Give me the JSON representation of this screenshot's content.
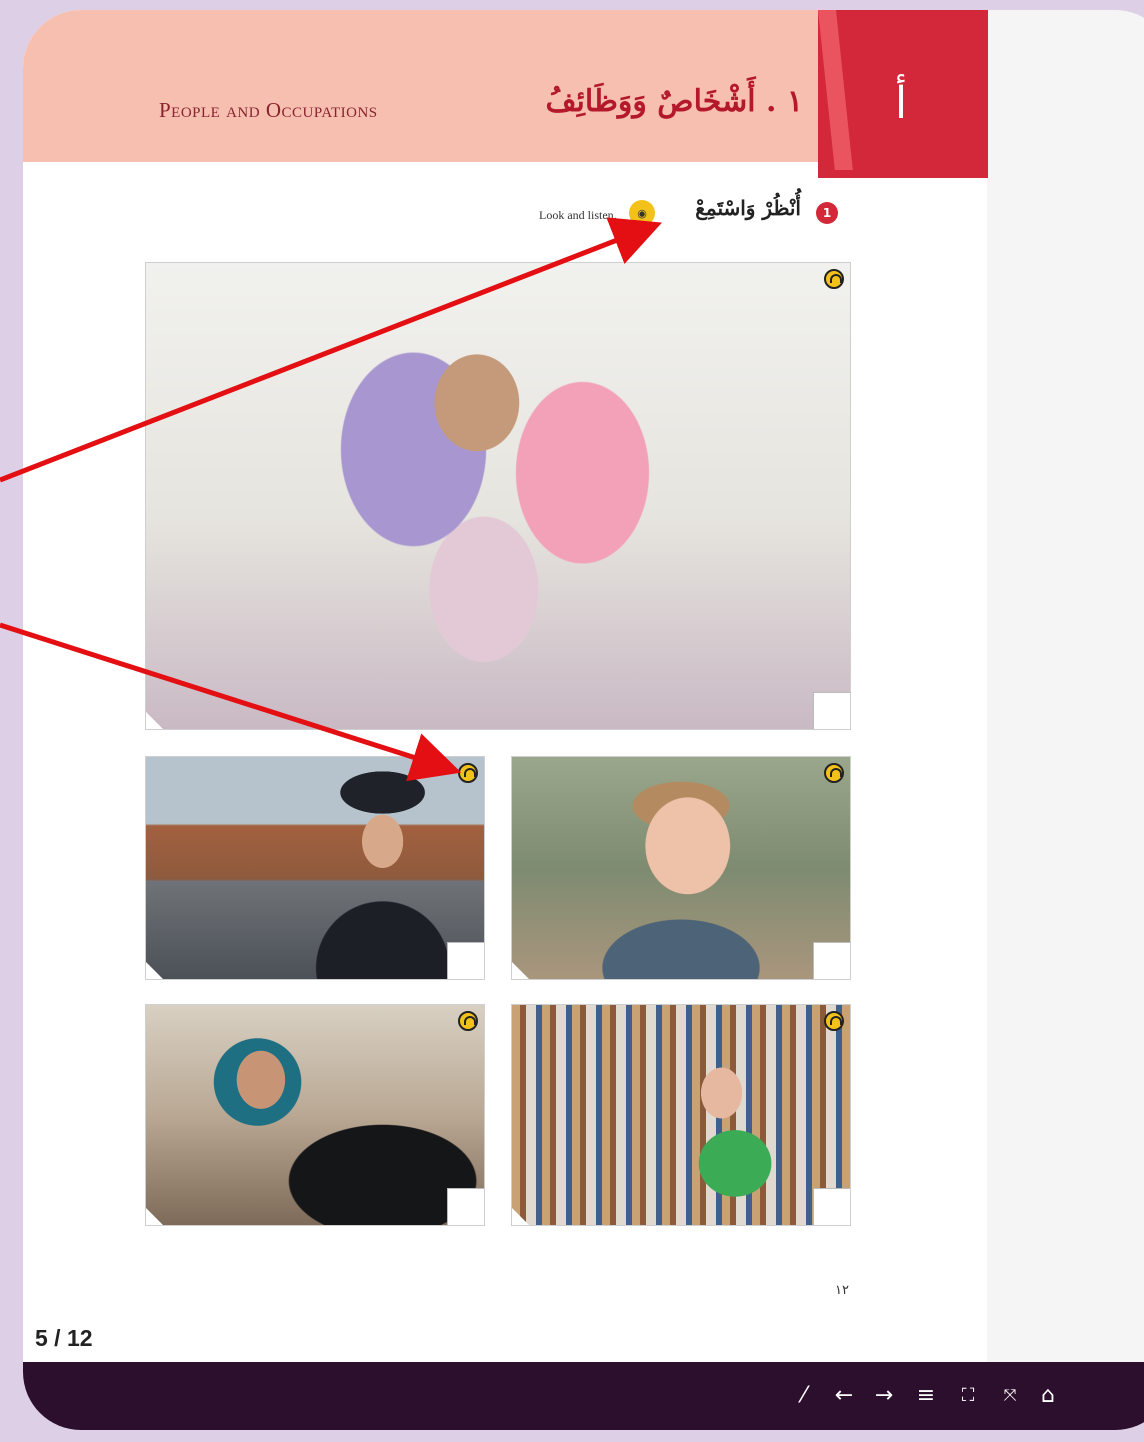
{
  "header": {
    "title_en": "People and Occupations",
    "title_ar": "١ . أَشْخَاصٌ وَوَظَائِفُ",
    "section_letter": "أ"
  },
  "instruction": {
    "number": "1",
    "text_ar": "أُنْظُرْ وَاسْتَمِعْ",
    "text_en": "Look and listen."
  },
  "photos": [
    {
      "name": "family-photo",
      "icon": "headphones-icon"
    },
    {
      "name": "police-officer-photo",
      "icon": "headphones-icon"
    },
    {
      "name": "baby-photo",
      "icon": "headphones-icon"
    },
    {
      "name": "woman-laptop-photo",
      "icon": "headphones-icon"
    },
    {
      "name": "student-library-photo",
      "icon": "headphones-icon"
    }
  ],
  "page_number_ar": "١٢",
  "page_counter": "5 / 12",
  "toolbar": {
    "items": [
      "pen-icon",
      "arrow-left-icon",
      "arrow-right-icon",
      "menu-icon",
      "fullscreen-icon",
      "fit-icon",
      "home-icon"
    ]
  },
  "colors": {
    "header_band": "#f7bfb0",
    "header_tab": "#d3283a",
    "audio_badge": "#f3c21a",
    "toolbar_bg": "#2c0f2d",
    "annotation_arrow": "#e30f12"
  }
}
